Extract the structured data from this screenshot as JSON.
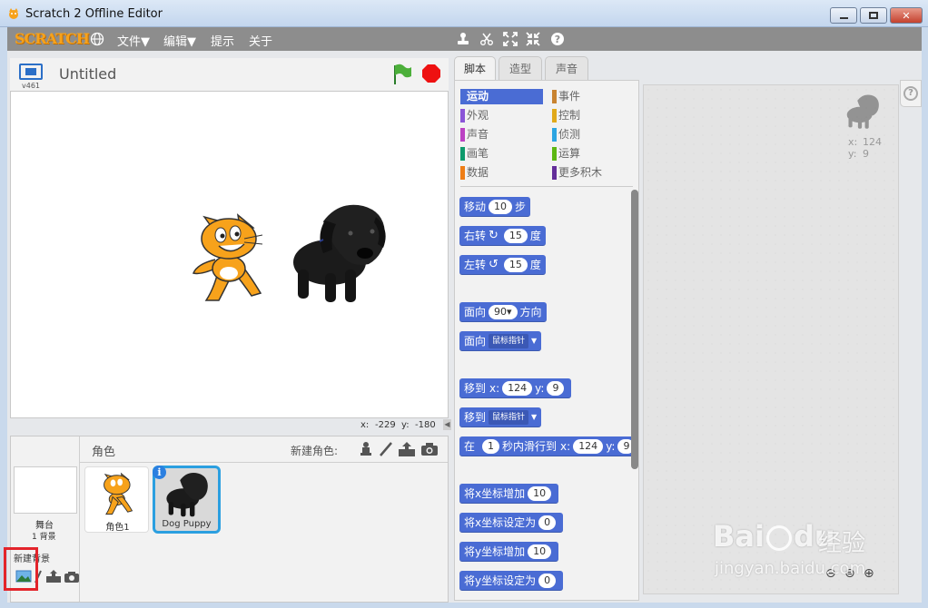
{
  "window": {
    "title": "Scratch 2 Offline Editor",
    "min_icon": "minimize-icon",
    "max_icon": "maximize-icon",
    "close_icon": "close-icon",
    "close_label": "✕"
  },
  "menu": {
    "logo": "SCRATCH",
    "items": [
      "文件▼",
      "编辑▼",
      "提示",
      "关于"
    ]
  },
  "stage": {
    "title": "Untitled",
    "version": "v461",
    "coord_x_label": "x:",
    "coord_x": "-229",
    "coord_y_label": "y:",
    "coord_y": "-180"
  },
  "tabs": [
    "脚本",
    "造型",
    "声音"
  ],
  "categories": {
    "left": [
      "运动",
      "外观",
      "声音",
      "画笔",
      "数据"
    ],
    "left_colors": [
      "#4a6cd4",
      "#8a55d7",
      "#bb42c3",
      "#0e9a6c",
      "#ee7d16"
    ],
    "right": [
      "事件",
      "控制",
      "侦测",
      "运算",
      "更多积木"
    ],
    "right_colors": [
      "#c88330",
      "#e1a91a",
      "#2ca5e2",
      "#5cb712",
      "#632d99"
    ]
  },
  "blocks": {
    "move": {
      "label": "移动",
      "value": "10",
      "suffix": "步"
    },
    "turn_right": {
      "label": "右转",
      "value": "15",
      "suffix": "度"
    },
    "turn_left": {
      "label": "左转",
      "value": "15",
      "suffix": "度"
    },
    "point_dir": {
      "label": "面向",
      "value": "90▾",
      "suffix": "方向"
    },
    "point_towards": {
      "label": "面向",
      "value": "鼠标指针"
    },
    "goto_xy": {
      "label": "移到",
      "x_label": "x:",
      "x": "124",
      "y_label": "y:",
      "y": "9"
    },
    "goto": {
      "label": "移到",
      "value": "鼠标指针"
    },
    "glide": {
      "label": "在",
      "secs": "1",
      "mid": "秒内滑行到",
      "x_label": "x:",
      "x": "124",
      "y_label": "y:",
      "y": "9"
    },
    "change_x": {
      "label": "将x坐标增加",
      "value": "10"
    },
    "set_x": {
      "label": "将x坐标设定为",
      "value": "0"
    },
    "change_y": {
      "label": "将y坐标增加",
      "value": "10"
    },
    "set_y": {
      "label": "将y坐标设定为",
      "value": "0"
    }
  },
  "script_area": {
    "sprite_x_label": "x:",
    "sprite_x": "124",
    "sprite_y_label": "y:",
    "sprite_y": "9"
  },
  "sprites": {
    "header": "角色",
    "new_label": "新建角色:",
    "stage_name": "舞台",
    "stage_backdrops": "1 背景",
    "new_backdrop_label": "新建背景",
    "items": [
      "角色1",
      "Dog Puppy"
    ]
  },
  "watermark": {
    "brand": "Bai",
    "brand2": "du",
    "brand3": "经验",
    "url": "jingyan.baidu.com"
  }
}
